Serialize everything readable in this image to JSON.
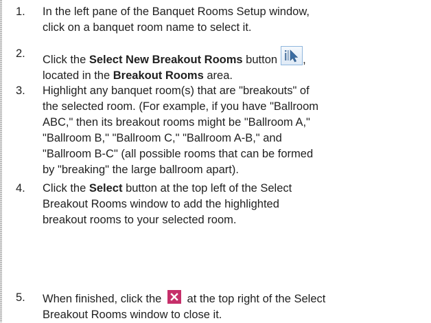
{
  "steps": [
    {
      "num": "1.",
      "line1": "In the left pane of the Banquet Rooms Setup window,",
      "line2": "click on a banquet room name to select it."
    },
    {
      "num": "2.",
      "pre": "Click the ",
      "bold1": "Select New Breakout Rooms",
      "mid": " button",
      "icon": "select-breakout-icon",
      "post": ",",
      "line2_pre": "located in the ",
      "bold2": "Breakout Rooms",
      "line2_post": " area."
    },
    {
      "num": "3.",
      "lines": [
        "Highlight any banquet room(s) that are \"breakouts\" of",
        "the selected room. (For example, if you have \"Ballroom",
        "ABC,\" then its breakout rooms might be \"Ballroom A,\"",
        "\"Ballroom B,\" \"Ballroom C,\" \"Ballroom A-B,\" and",
        "\"Ballroom B-C\" (all possible rooms that can be formed",
        "by \"breaking\" the large ballroom apart)."
      ]
    },
    {
      "num": "4.",
      "pre": "Click the ",
      "bold": "Select",
      "post": " button at the top left of the Select",
      "line2": "Breakout Rooms window to add the highlighted",
      "line3": "breakout rooms to your selected room."
    },
    {
      "num": "5.",
      "pre": "When finished, click the",
      "icon": "close-icon",
      "post": "at the top right of the Select",
      "line2": "Breakout Rooms window to close it."
    }
  ],
  "colors": {
    "close_icon_bg": "#c62f6a",
    "breakout_icon_border": "#8fb6dd",
    "text": "#1f1f1f"
  }
}
